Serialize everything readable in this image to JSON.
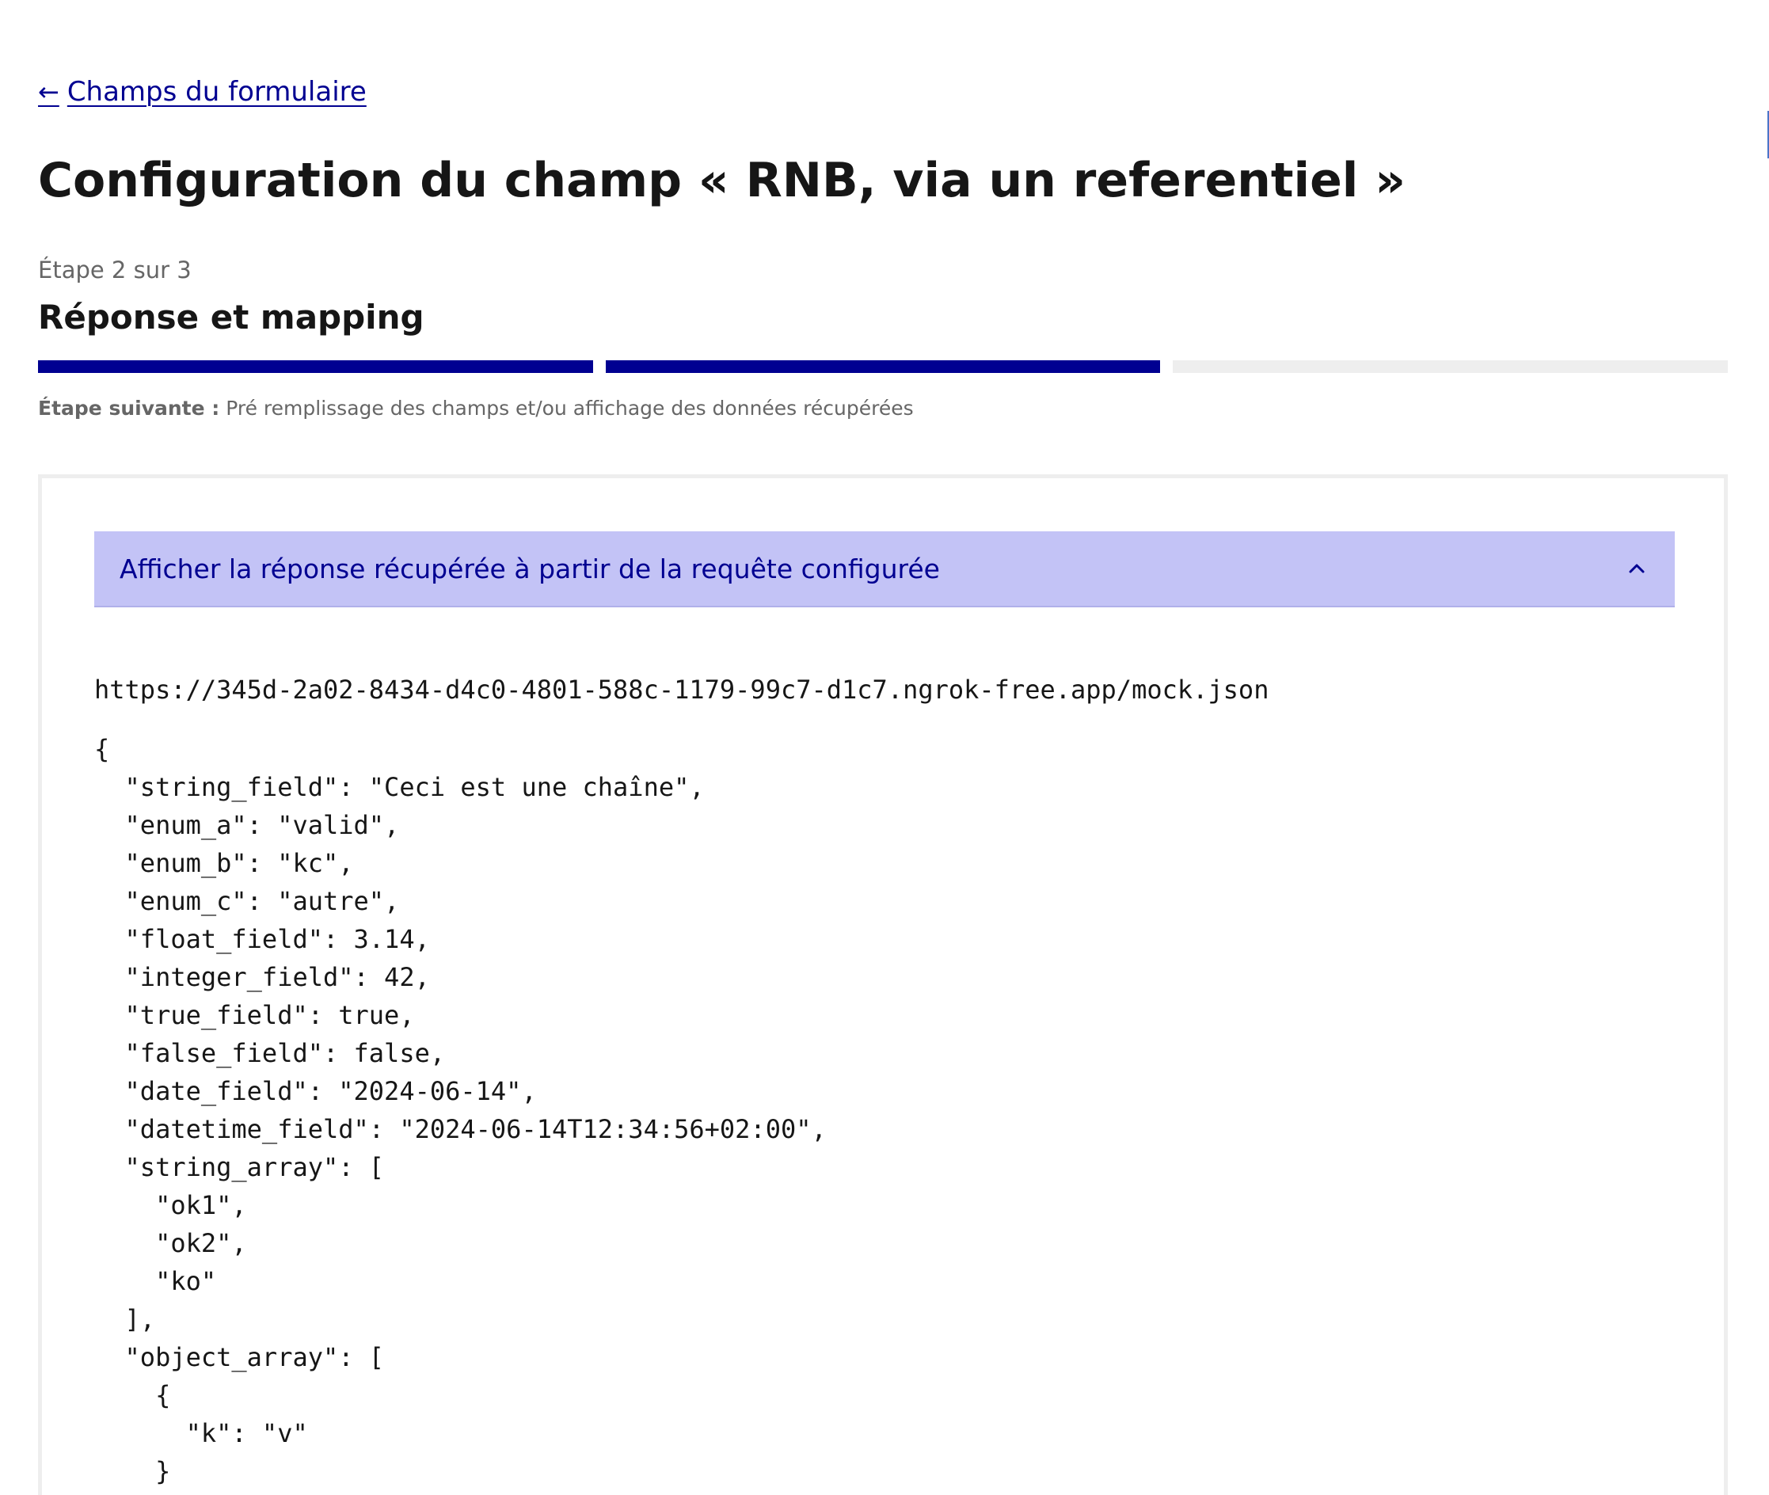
{
  "nav": {
    "back_arrow": "←",
    "back_label": "Champs du formulaire"
  },
  "header": {
    "title": "Configuration du champ « RNB, via un referentiel »"
  },
  "stepper": {
    "step_count": "Étape 2 sur 3",
    "step_title": "Réponse et mapping",
    "current_step": 2,
    "total_steps": 3,
    "next_step_label": "Étape suivante :",
    "next_step_text": "Pré remplissage des champs et/ou affichage des données récupérées"
  },
  "accordion": {
    "title": "Afficher la réponse récupérée à partir de la requête configurée",
    "icon": "chevron-up-icon",
    "expanded": true
  },
  "response": {
    "url": "https://345d-2a02-8434-d4c0-4801-588c-1179-99c7-d1c7.ngrok-free.app/mock.json",
    "json_lines": [
      "{",
      "  \"string_field\": \"Ceci est une chaîne\",",
      "  \"enum_a\": \"valid\",",
      "  \"enum_b\": \"kc\",",
      "  \"enum_c\": \"autre\",",
      "  \"float_field\": 3.14,",
      "  \"integer_field\": 42,",
      "  \"true_field\": true,",
      "  \"false_field\": false,",
      "  \"date_field\": \"2024-06-14\",",
      "  \"datetime_field\": \"2024-06-14T12:34:56+02:00\",",
      "  \"string_array\": [",
      "    \"ok1\",",
      "    \"ok2\",",
      "    \"ko\"",
      "  ],",
      "  \"object_array\": [",
      "    {",
      "      \"k\": \"v\"",
      "    }"
    ]
  },
  "colors": {
    "primary": "#000091",
    "accordion_bg": "#c3c3f6",
    "muted_text": "#666666",
    "border": "#eeeeee"
  }
}
